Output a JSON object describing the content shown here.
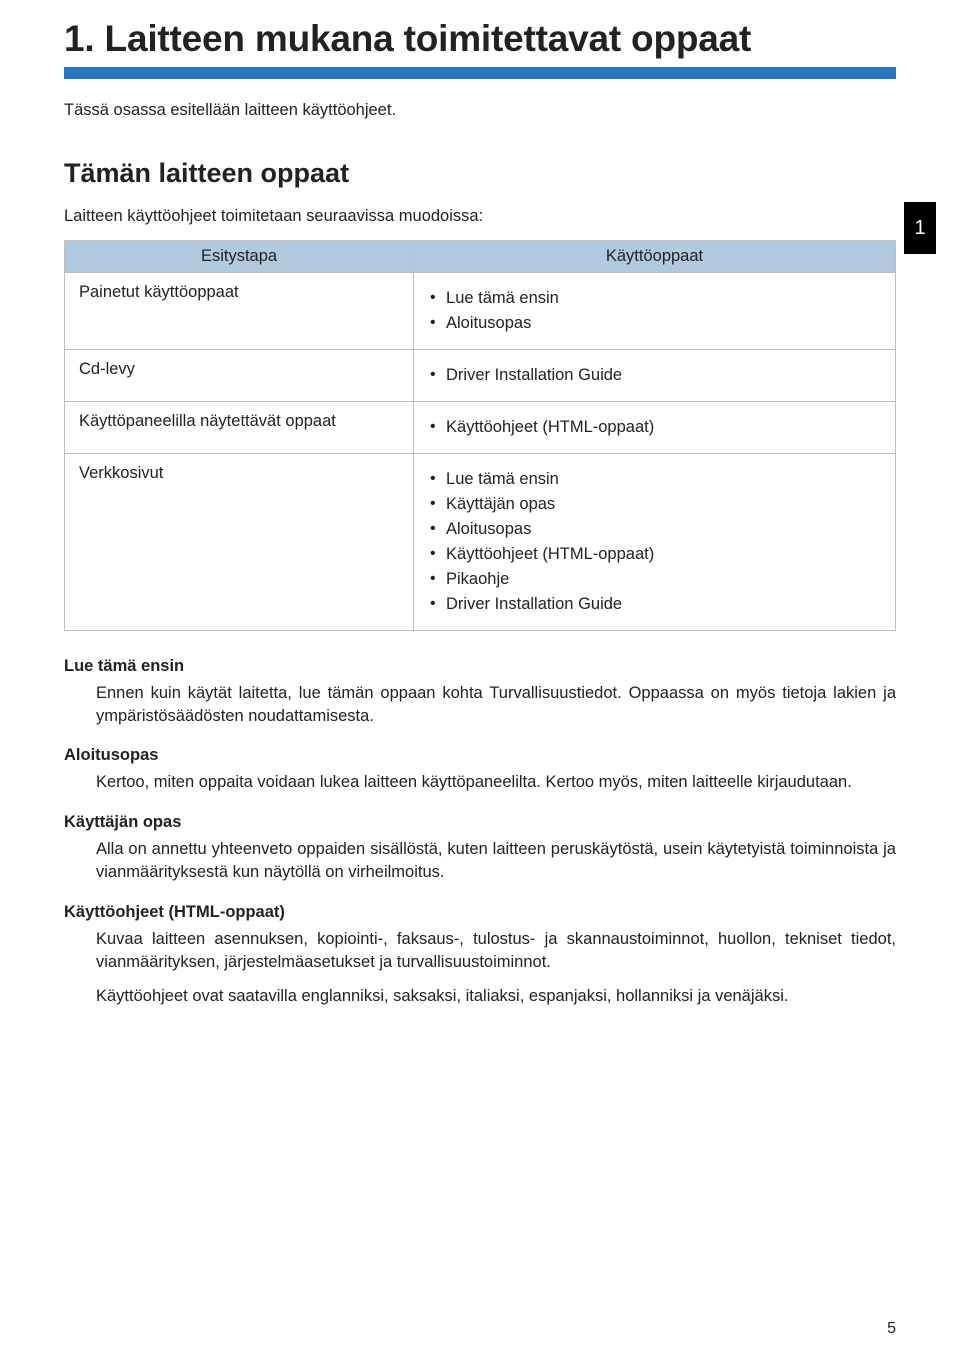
{
  "chapter": {
    "title": "1. Laitteen mukana toimitettavat oppaat",
    "underline_color": "#2876bb",
    "intro": "Tässä osassa esitellään laitteen käyttöohjeet."
  },
  "side_tab": {
    "label": "1"
  },
  "section": {
    "title": "Tämän laitteen oppaat",
    "lead": "Laitteen käyttöohjeet toimitetaan seuraavissa muodoissa:"
  },
  "table": {
    "headers": {
      "col1": "Esitystapa",
      "col2": "Käyttöoppaat"
    },
    "rows": [
      {
        "label": "Painetut käyttöoppaat",
        "items": [
          "Lue tämä ensin",
          "Aloitusopas"
        ]
      },
      {
        "label": "Cd-levy",
        "items": [
          "Driver Installation Guide"
        ]
      },
      {
        "label": "Käyttöpaneelilla näytettävät oppaat",
        "items": [
          "Käyttöohjeet (HTML-oppaat)"
        ]
      },
      {
        "label": "Verkkosivut",
        "items": [
          "Lue tämä ensin",
          "Käyttäjän opas",
          "Aloitusopas",
          "Käyttöohjeet (HTML-oppaat)",
          "Pikaohje",
          "Driver Installation Guide"
        ]
      }
    ]
  },
  "definitions": [
    {
      "term": "Lue tämä ensin",
      "paras": [
        "Ennen kuin käytät laitetta, lue tämän oppaan kohta Turvallisuustiedot. Oppaassa on myös tietoja lakien ja ympäristösäädösten noudattamisesta."
      ]
    },
    {
      "term": "Aloitusopas",
      "paras": [
        "Kertoo, miten oppaita voidaan lukea laitteen käyttöpaneelilta. Kertoo myös, miten laitteelle kirjaudutaan."
      ]
    },
    {
      "term": "Käyttäjän opas",
      "paras": [
        "Alla on annettu yhteenveto oppaiden sisällöstä, kuten laitteen peruskäytöstä, usein käytetyistä toiminnoista ja vianmäärityksestä kun näytöllä on virheilmoitus."
      ]
    },
    {
      "term": "Käyttöohjeet (HTML-oppaat)",
      "paras": [
        "Kuvaa laitteen asennuksen, kopiointi-, faksaus-, tulostus- ja skannaustoiminnot, huollon, tekniset tiedot, vianmäärityksen, järjestelmäasetukset ja turvallisuustoiminnot.",
        "Käyttöohjeet ovat saatavilla englanniksi, saksaksi, italiaksi, espanjaksi, hollanniksi ja venäjäksi."
      ]
    }
  ],
  "page_number": "5"
}
